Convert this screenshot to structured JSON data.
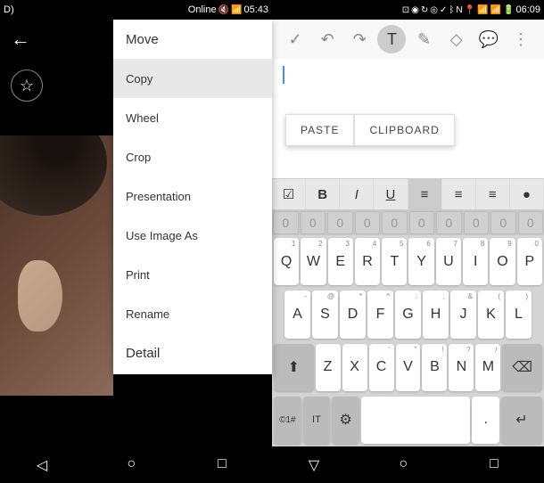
{
  "left": {
    "status": {
      "carrier": "D)",
      "online": "Online",
      "time": "05:43"
    },
    "back": "←",
    "star": "☆"
  },
  "right": {
    "status": {
      "time": "06:09"
    },
    "toolbar": {
      "check": "✓",
      "undo": "↶",
      "redo": "↷",
      "text": "T",
      "pen": "✎",
      "erase": "◇",
      "chat": "💬",
      "more": "⋮"
    },
    "paste": {
      "paste_label": "PASTE",
      "clipboard_label": "CLIPBOARD"
    },
    "format": {
      "check": "☑",
      "bold": "B",
      "italic": "I",
      "underline": "U",
      "left": "≡",
      "center": "≡",
      "right": "≡",
      "bullet": "●"
    }
  },
  "menu": {
    "items": [
      {
        "label": "Move"
      },
      {
        "label": "Copy"
      },
      {
        "label": "Wheel"
      },
      {
        "label": "Crop"
      },
      {
        "label": "Presentation"
      },
      {
        "label": "Use Image As"
      },
      {
        "label": "Print"
      },
      {
        "label": "Rename"
      },
      {
        "label": "Detail"
      }
    ]
  },
  "keyboard": {
    "nums": [
      "0",
      "0",
      "0",
      "0",
      "0",
      "0",
      "0",
      "0",
      "0",
      "0"
    ],
    "row1": [
      {
        "k": "Q",
        "s": "1"
      },
      {
        "k": "W",
        "s": "2"
      },
      {
        "k": "E",
        "s": "3"
      },
      {
        "k": "R",
        "s": "4"
      },
      {
        "k": "T",
        "s": "5"
      },
      {
        "k": "Y",
        "s": "6"
      },
      {
        "k": "U",
        "s": "7"
      },
      {
        "k": "I",
        "s": "8"
      },
      {
        "k": "O",
        "s": "9"
      },
      {
        "k": "P",
        "s": "0"
      }
    ],
    "row2": [
      {
        "k": "A",
        "s": "-"
      },
      {
        "k": "S",
        "s": "@"
      },
      {
        "k": "D",
        "s": "*"
      },
      {
        "k": "F",
        "s": "^"
      },
      {
        "k": "G",
        "s": ":"
      },
      {
        "k": "H",
        "s": ";"
      },
      {
        "k": "J",
        "s": "&"
      },
      {
        "k": "K",
        "s": "("
      },
      {
        "k": "L",
        "s": ")"
      }
    ],
    "row3": [
      {
        "k": "Z",
        "s": ""
      },
      {
        "k": "X",
        "s": ""
      },
      {
        "k": "C",
        "s": "'"
      },
      {
        "k": "V",
        "s": "\""
      },
      {
        "k": "B",
        "s": "!"
      },
      {
        "k": "N",
        "s": "?"
      },
      {
        "k": "M",
        "s": "/"
      }
    ],
    "shift": "⬆",
    "backspace": "⌫",
    "sym": "©1#",
    "lang": "IT",
    "settings": "⚙",
    "space": " ",
    "dot": ".",
    "enter": "↵"
  },
  "nav": {
    "back": "◁",
    "home": "○",
    "recent": "□",
    "down": "▽"
  }
}
